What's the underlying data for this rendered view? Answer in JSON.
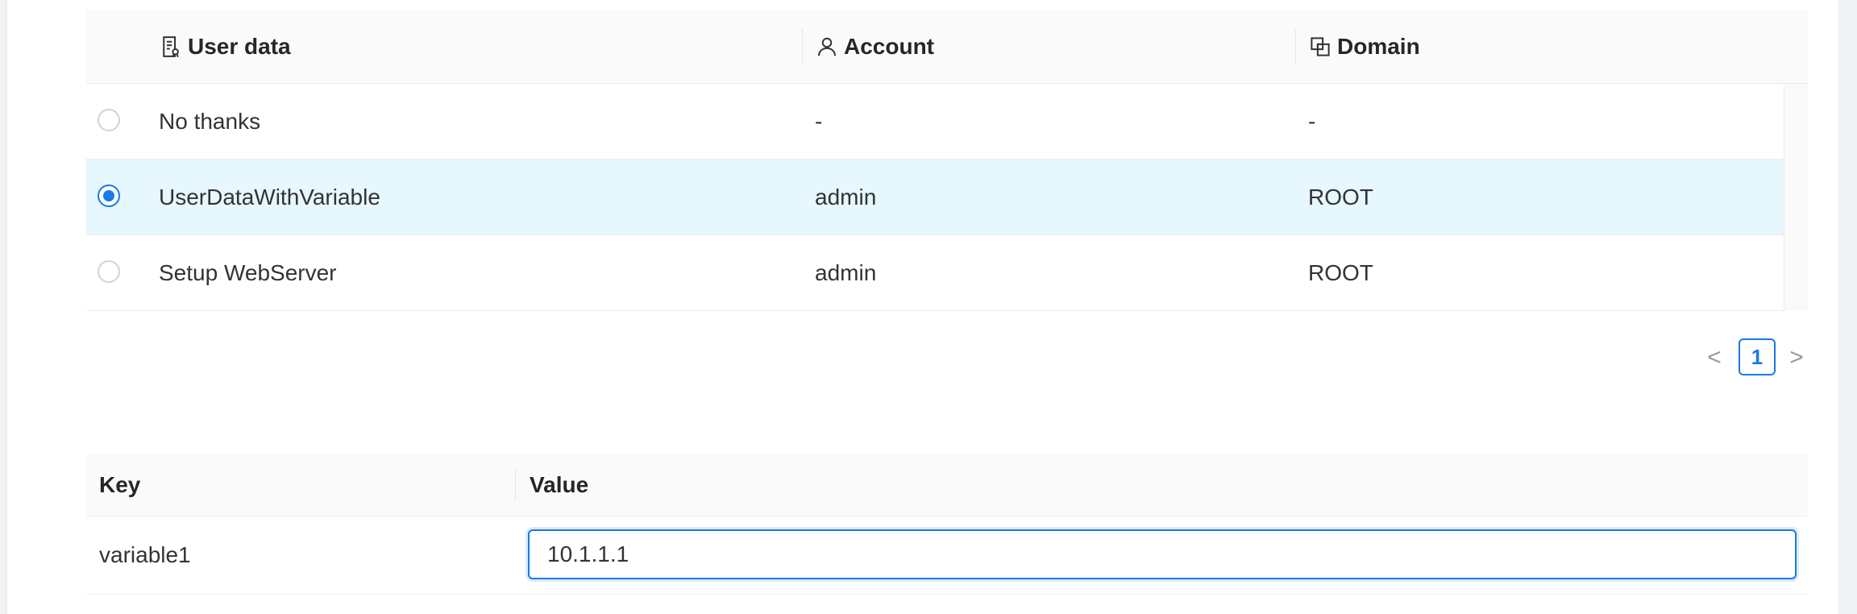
{
  "userdata_table": {
    "columns": {
      "userdata": "User data",
      "account": "Account",
      "domain": "Domain"
    },
    "rows": [
      {
        "name": "No thanks",
        "account": "-",
        "domain": "-",
        "selected": false
      },
      {
        "name": "UserDataWithVariable",
        "account": "admin",
        "domain": "ROOT",
        "selected": true
      },
      {
        "name": "Setup WebServer",
        "account": "admin",
        "domain": "ROOT",
        "selected": false
      }
    ]
  },
  "pagination": {
    "prev": "<",
    "current_page": "1",
    "next": ">"
  },
  "variables_table": {
    "columns": {
      "key": "Key",
      "value": "Value"
    },
    "rows": [
      {
        "key": "variable1",
        "value": "10.1.1.1"
      }
    ]
  },
  "colors": {
    "accent": "#1a78e8",
    "selected_row": "#e6f7fd",
    "header_bg": "#fafafa"
  },
  "icons": {
    "userdata": "file-text-icon",
    "account": "user-icon",
    "domain": "block-icon"
  }
}
